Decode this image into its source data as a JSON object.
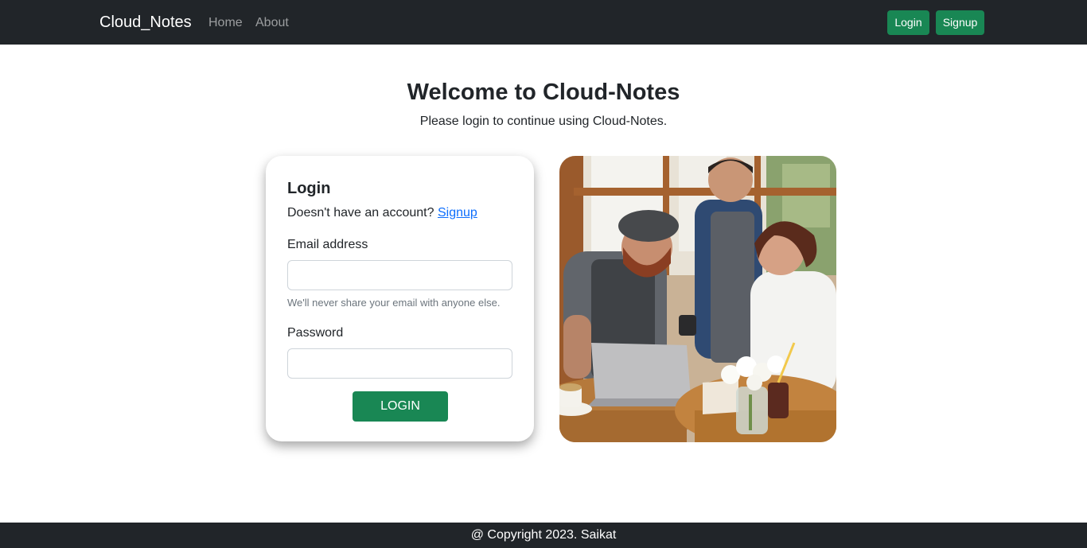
{
  "navbar": {
    "brand": "Cloud_Notes",
    "links": [
      "Home",
      "About"
    ],
    "login_button": "Login",
    "signup_button": "Signup"
  },
  "hero": {
    "title": "Welcome to Cloud-Notes",
    "subtitle": "Please login to continue using Cloud-Notes."
  },
  "login_form": {
    "title": "Login",
    "prompt": "Doesn't have an account?",
    "signup_link": "Signup",
    "email_label": "Email address",
    "email_value": "",
    "email_help": "We'll never share your email with anyone else.",
    "password_label": "Password",
    "password_value": "",
    "submit_label": "LOGIN"
  },
  "image": {
    "alt": ""
  },
  "footer": {
    "copyright": "@ Copyright 2023. Saikat"
  },
  "colors": {
    "navbar_bg": "#212529",
    "accent_green": "#198754",
    "link_blue": "#0d6efd"
  }
}
